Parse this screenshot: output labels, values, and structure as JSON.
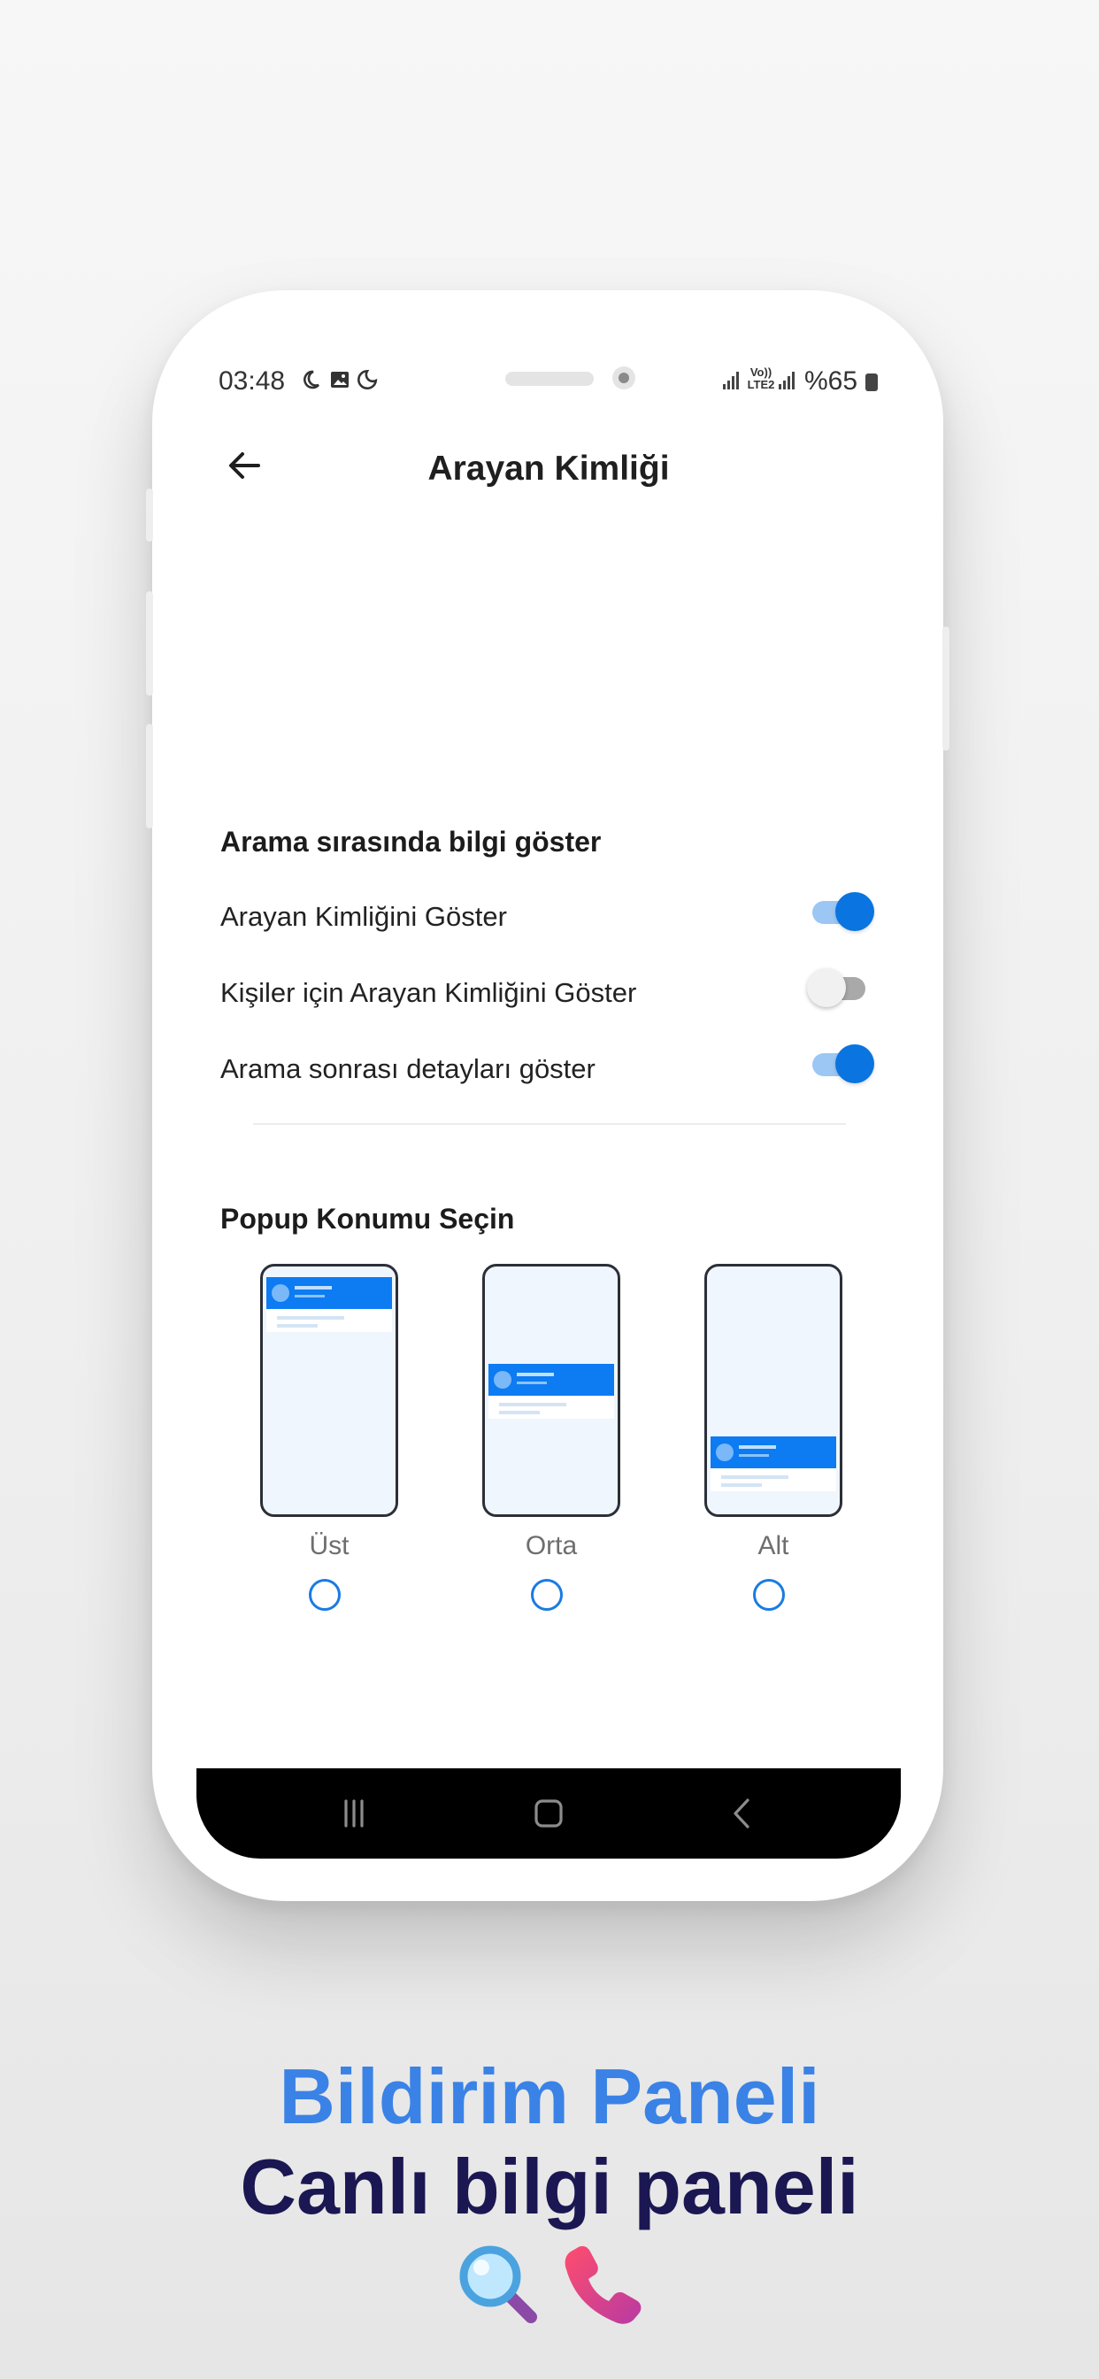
{
  "status_bar": {
    "time": "03:48",
    "network_label": "Vo)) LTE2",
    "battery": "%65",
    "icons": [
      "moon-icon",
      "image-icon",
      "moon-phone-icon",
      "signal-icon",
      "battery-icon"
    ]
  },
  "app_bar": {
    "title": "Arayan Kimliği",
    "back_icon": "arrow-left-icon"
  },
  "section_info": {
    "title": "Arama sırasında bilgi göster",
    "settings": [
      {
        "label": "Arayan Kimliğini Göster",
        "enabled": true
      },
      {
        "label": "Kişiler için Arayan Kimliğini Göster",
        "enabled": false
      },
      {
        "label": "Arama sonrası detayları göster",
        "enabled": true
      }
    ]
  },
  "section_popup": {
    "title": "Popup Konumu Seçin",
    "options": [
      {
        "label": "Üst",
        "selected": false
      },
      {
        "label": "Orta",
        "selected": false
      },
      {
        "label": "Alt",
        "selected": false
      }
    ]
  },
  "nav_bar": {
    "icons": [
      "recent-apps-icon",
      "home-icon",
      "back-icon"
    ]
  },
  "promo": {
    "line1": "Bildirim Paneli",
    "line2": "Canlı  bilgi paneli",
    "emojis": [
      "magnifier-emoji",
      "phone-receiver-emoji"
    ]
  },
  "colors": {
    "accent": "#0a74e0",
    "promo_blue": "#3a82e6",
    "promo_navy": "#1b1752"
  }
}
